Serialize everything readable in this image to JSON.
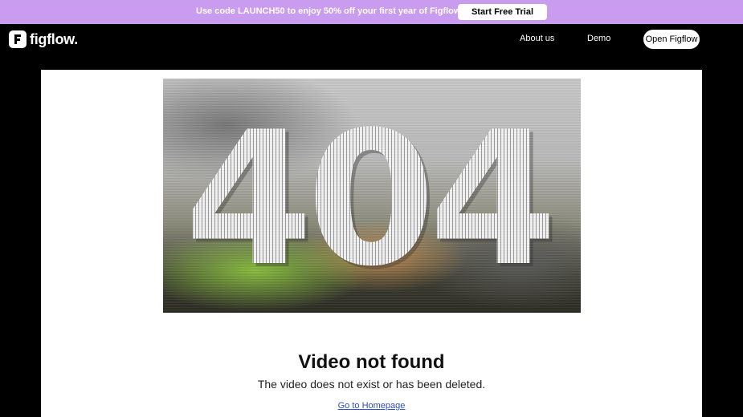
{
  "promo": {
    "text": "Use code LAUNCH50 to enjoy 50% off your first year of Figflow!",
    "button_label": "Start Free Trial",
    "background": "#c99cf0"
  },
  "header": {
    "logo_text": "figflow.",
    "logo_icon": "figflow-logo-icon",
    "nav": {
      "about": "About us",
      "demo": "Demo",
      "open": "Open Figflow"
    }
  },
  "video": {
    "glitch_text": "404"
  },
  "message": {
    "title": "Video not found",
    "subtitle": "The video does not exist or has been deleted.",
    "home_link": "Go to Homepage"
  }
}
